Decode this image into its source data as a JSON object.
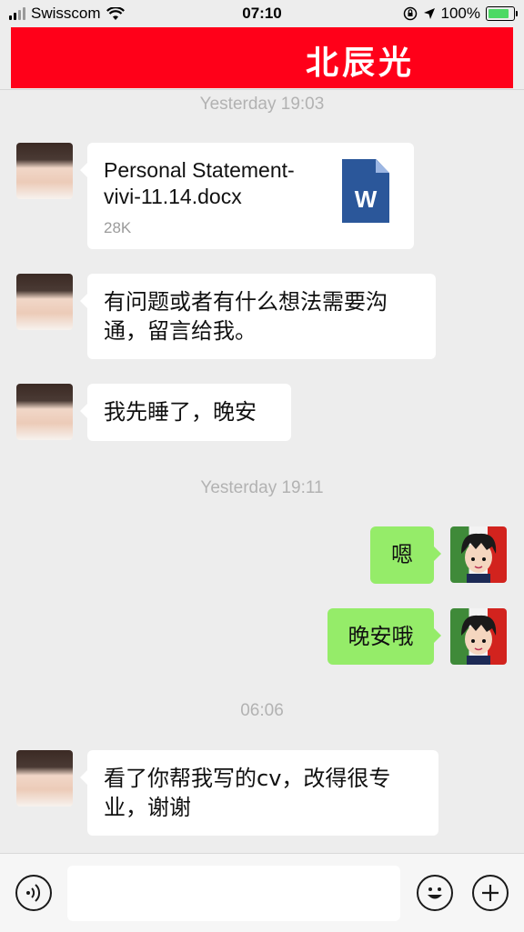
{
  "status_bar": {
    "carrier": "Swisscom",
    "time": "07:10",
    "battery": "100%"
  },
  "header": {
    "title": "北辰光"
  },
  "messages": {
    "timestamp_1": "Yesterday 19:03",
    "file": {
      "name": "Personal Statement-vivi-11.14.docx",
      "size": "28K",
      "icon_letter": "W",
      "icon": "word-doc-icon"
    },
    "msg_1": "有问题或者有什么想法需要沟通，留言给我。",
    "msg_2": "我先睡了，晚安",
    "timestamp_2": "Yesterday 19:11",
    "msg_3": "嗯",
    "msg_4": "晚安哦",
    "timestamp_3": "06:06",
    "msg_5": "看了你帮我写的cv，改得很专业，谢谢"
  },
  "input_bar": {
    "voice_icon": "voice-icon",
    "emoji_icon": "emoji-icon",
    "add_icon": "plus-icon"
  },
  "colors": {
    "header_red": "#ff0019",
    "outgoing_bubble": "#95ec69",
    "word_blue": "#2b579a"
  }
}
